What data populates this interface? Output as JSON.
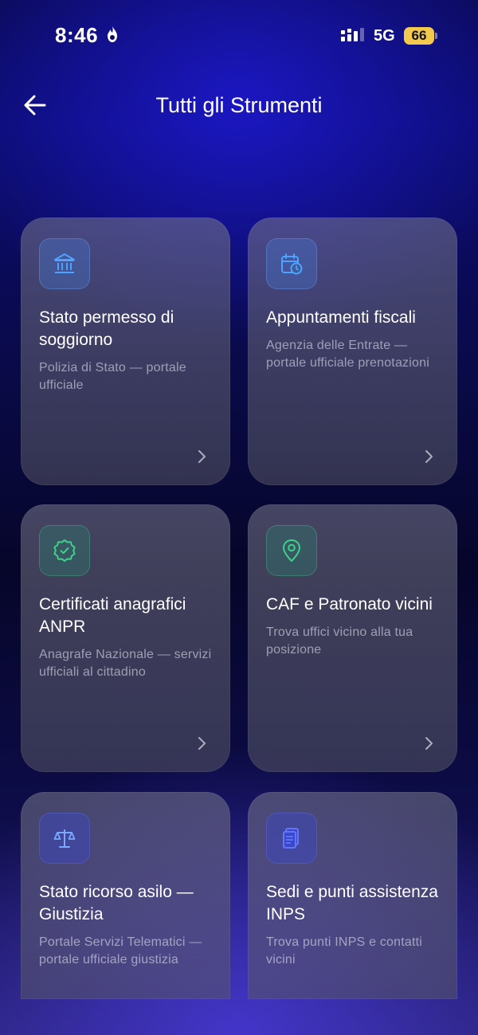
{
  "status_bar": {
    "time": "8:46",
    "network": "5G",
    "battery": "66"
  },
  "header": {
    "title": "Tutti gli Strumenti"
  },
  "cards": [
    {
      "title": "Stato permesso di soggiorno",
      "description": "Polizia di Stato — portale ufficiale",
      "icon": "bank-icon"
    },
    {
      "title": "Appuntamenti fiscali",
      "description": "Agenzia delle Entrate — portale ufficiale prenotazioni",
      "icon": "calendar-clock-icon"
    },
    {
      "title": "Certificati anagrafici ANPR",
      "description": "Anagrafe Nazionale — servizi ufficiali al cittadino",
      "icon": "verified-badge-icon"
    },
    {
      "title": "CAF e Patronato vicini",
      "description": "Trova uffici vicino alla tua posizione",
      "icon": "map-pin-icon"
    },
    {
      "title": "Stato ricorso asilo — Giustizia",
      "description": "Portale Servizi Telematici — portale ufficiale giustizia",
      "icon": "scales-icon"
    },
    {
      "title": "Sedi e punti assistenza INPS",
      "description": "Trova punti INPS e contatti vicini",
      "icon": "document-stack-icon"
    }
  ],
  "colors": {
    "battery": "#f2c94c",
    "icon_blue": "#4da3ff",
    "icon_green": "#3fd08a",
    "icon_indigo": "#5a6cff"
  }
}
